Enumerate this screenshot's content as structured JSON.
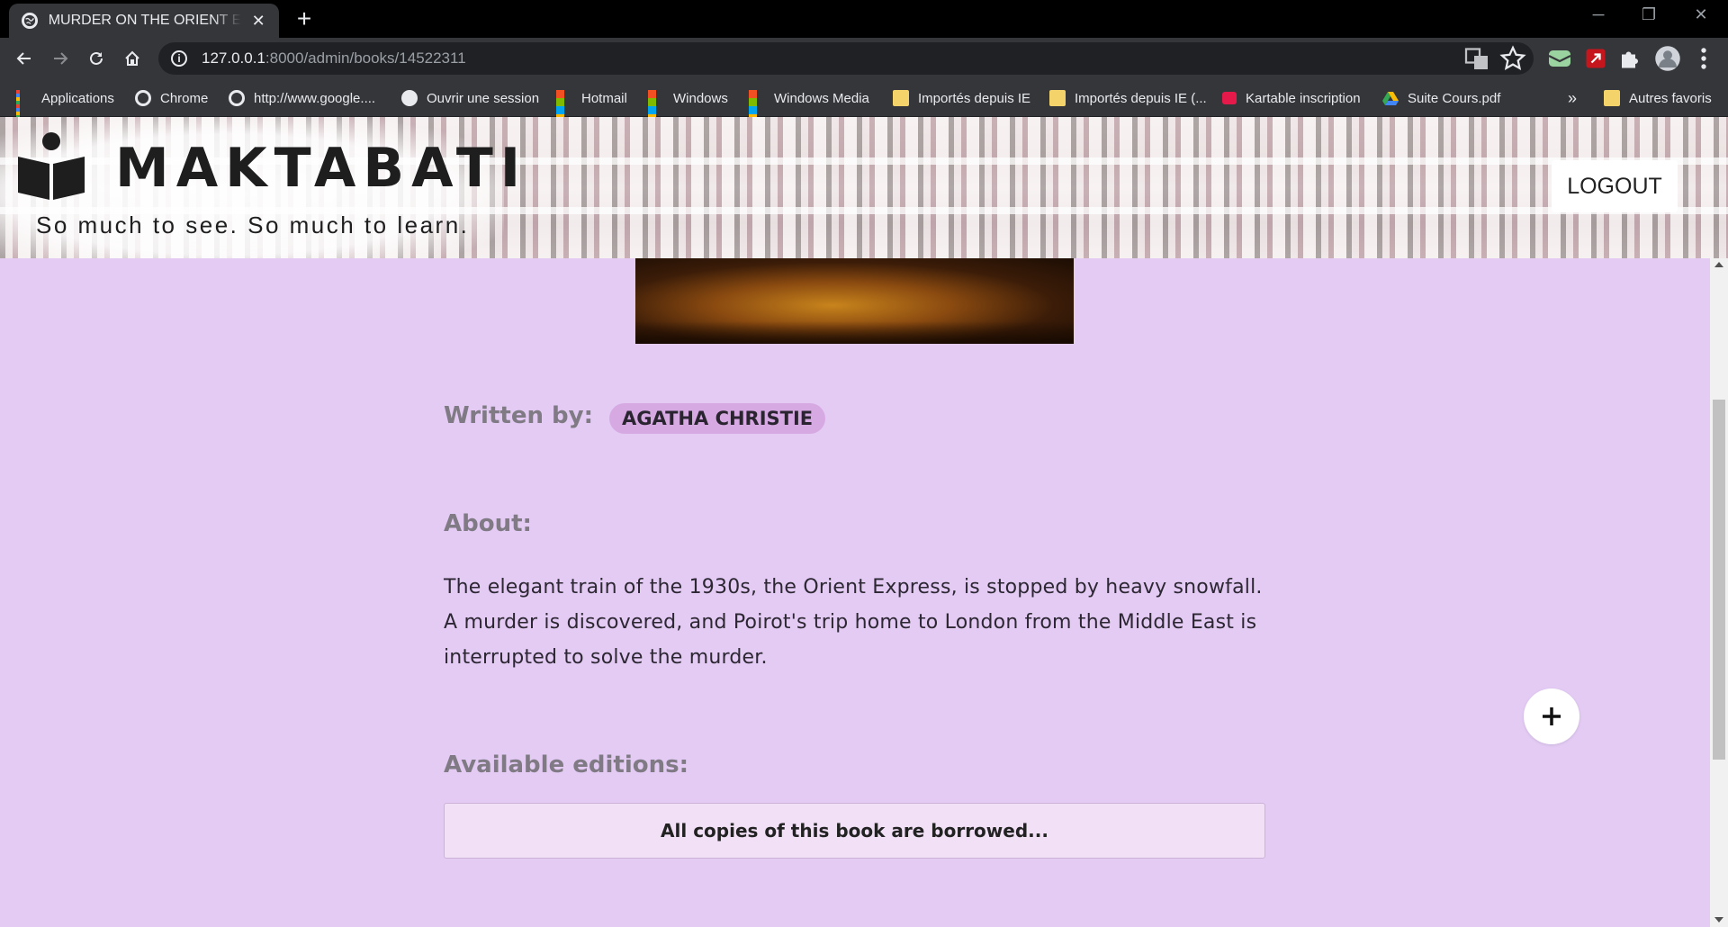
{
  "browser": {
    "tab_title": "MURDER ON THE ORIENT EXPRESS",
    "tab_close": "✕",
    "new_tab": "+",
    "url_host": "127.0.0.1",
    "url_path": ":8000/admin/books/14522311",
    "window_controls": [
      "─",
      "❐",
      "✕"
    ],
    "bookmarks": [
      {
        "label": "Applications",
        "icon": "apps-icon"
      },
      {
        "label": "Chrome",
        "icon": "google-icon"
      },
      {
        "label": "http://www.google....",
        "icon": "google-icon"
      },
      {
        "label": "Ouvrir une session",
        "icon": "globe-icon"
      },
      {
        "label": "Hotmail",
        "icon": "windows-icon"
      },
      {
        "label": "Windows",
        "icon": "windows-icon"
      },
      {
        "label": "Windows Media",
        "icon": "windows-icon"
      },
      {
        "label": "Importés depuis IE",
        "icon": "folder-icon"
      },
      {
        "label": "Importés depuis IE (...",
        "icon": "folder-icon"
      },
      {
        "label": "Kartable inscription",
        "icon": "kartable-icon"
      },
      {
        "label": "Suite Cours.pdf",
        "icon": "drive-icon"
      }
    ],
    "bookmarks_overflow": "»",
    "other_bookmarks": "Autres favoris"
  },
  "header": {
    "brand": "MAKTABATI",
    "tagline": "So much to see. So much to learn.",
    "logout_label": "LOGOUT"
  },
  "book": {
    "written_by_label": "Written by:",
    "author": "AGATHA CHRISTIE",
    "about_label": "About:",
    "about_text": "The elegant train of the 1930s, the Orient Express, is stopped by heavy snowfall. A murder is discovered, and Poirot's trip home to London from the Middle East is interrupted to solve the murder.",
    "editions_label": "Available editions:",
    "editions_message": "All copies of this book are borrowed..."
  },
  "colors": {
    "page_bg": "#e3cbf4",
    "author_chip": "#d7a9e3",
    "label_gray": "#7f7a84"
  }
}
